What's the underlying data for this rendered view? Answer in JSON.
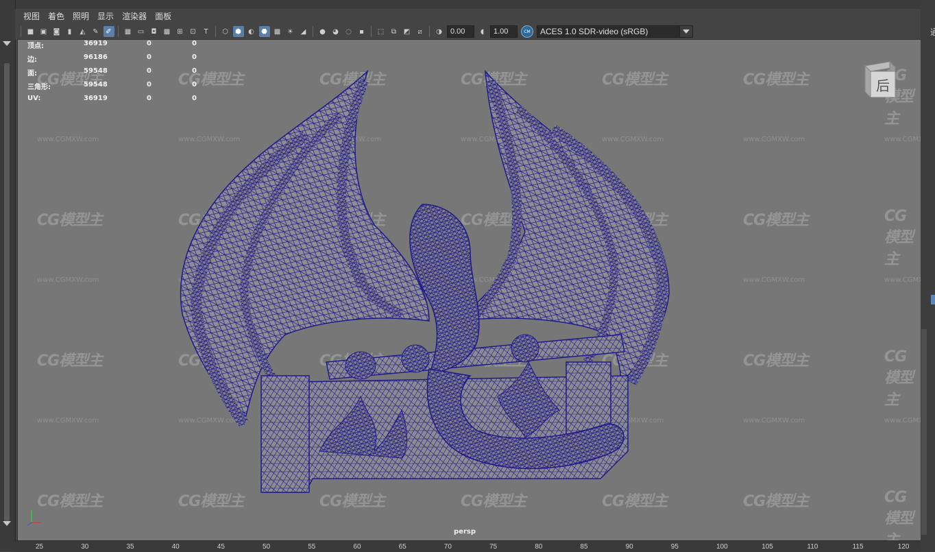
{
  "menu": [
    "视图",
    "着色",
    "照明",
    "显示",
    "渲染器",
    "面板"
  ],
  "toolbar": {
    "exposure_value": "0.00",
    "gamma_value": "1.00",
    "color_space": "ACES 1.0 SDR-video (sRGB)"
  },
  "hud": {
    "rows": [
      {
        "label": "顶点:",
        "v1": "36919",
        "v2": "0",
        "v3": "0"
      },
      {
        "label": "边:",
        "v1": "96186",
        "v2": "0",
        "v3": "0"
      },
      {
        "label": "面:",
        "v1": "59548",
        "v2": "0",
        "v3": "0"
      },
      {
        "label": "三角形:",
        "v1": "59548",
        "v2": "0",
        "v3": "0"
      },
      {
        "label": "UV:",
        "v1": "36919",
        "v2": "0",
        "v3": "0"
      }
    ]
  },
  "viewport": {
    "camera_label": "persp",
    "viewcube_face": "后",
    "watermark_logo": "CG模型主",
    "watermark_url": "www.CGMXW.com"
  },
  "right_panel_text": "通",
  "ruler_ticks": [
    "25",
    "30",
    "35",
    "40",
    "45",
    "50",
    "55",
    "60",
    "65",
    "70",
    "75",
    "80",
    "85",
    "90",
    "95",
    "100",
    "105",
    "110",
    "115",
    "120"
  ],
  "colors": {
    "wireframe": "#1f1a8c",
    "mesh_fill": "#8a8a90",
    "viewport_bg": "#777777",
    "active_tool": "#5b7fa6"
  }
}
